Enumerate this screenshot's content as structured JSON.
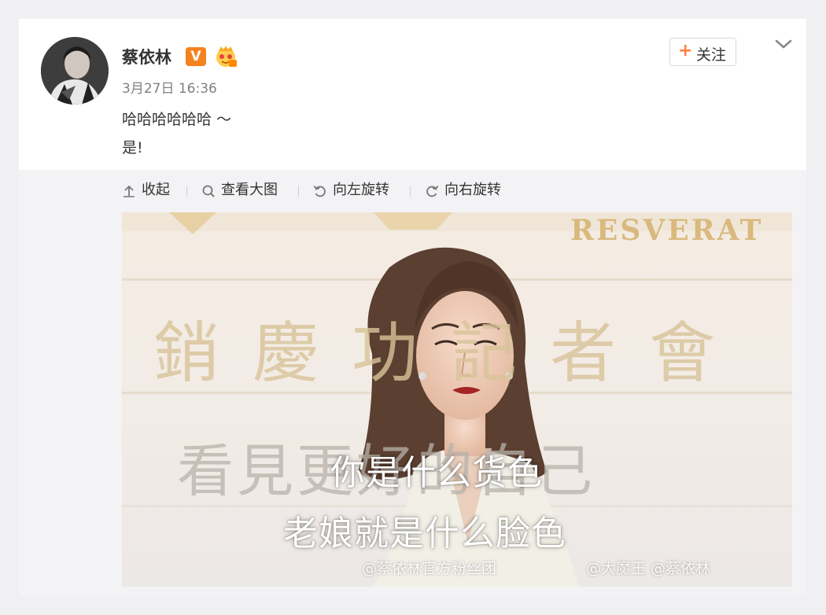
{
  "post": {
    "author_name": "蔡依林",
    "verified_badge_text": "V",
    "timestamp": "3月27日 16:36",
    "text_lines": [
      "哈哈哈哈哈哈 ～",
      "是!"
    ],
    "follow_label": "关注",
    "follow_plus": "+"
  },
  "media_toolbar": {
    "items": [
      {
        "label": "收起",
        "icon": "collapse-icon"
      },
      {
        "label": "查看大图",
        "icon": "zoom-icon"
      },
      {
        "label": "向左旋转",
        "icon": "rotate-left-icon"
      },
      {
        "label": "向右旋转",
        "icon": "rotate-right-icon"
      }
    ]
  },
  "photo": {
    "bg_top_text": "RESVERAT",
    "bg_big_text": "銷慶功記者會",
    "bg_mid_text": "看見更好的自己",
    "caption_line1": "你是什么货色",
    "caption_line2": "老娘就是什么脸色",
    "watermark_1": "@蔡依林官方粉丝团",
    "watermark_2": "@大魔王 @蔡依林"
  },
  "colors": {
    "accent_orange": "#ff8140",
    "verified_orange": "#f5821f",
    "page_bg": "#f0f0f2",
    "media_bg": "#f3f3f5"
  }
}
